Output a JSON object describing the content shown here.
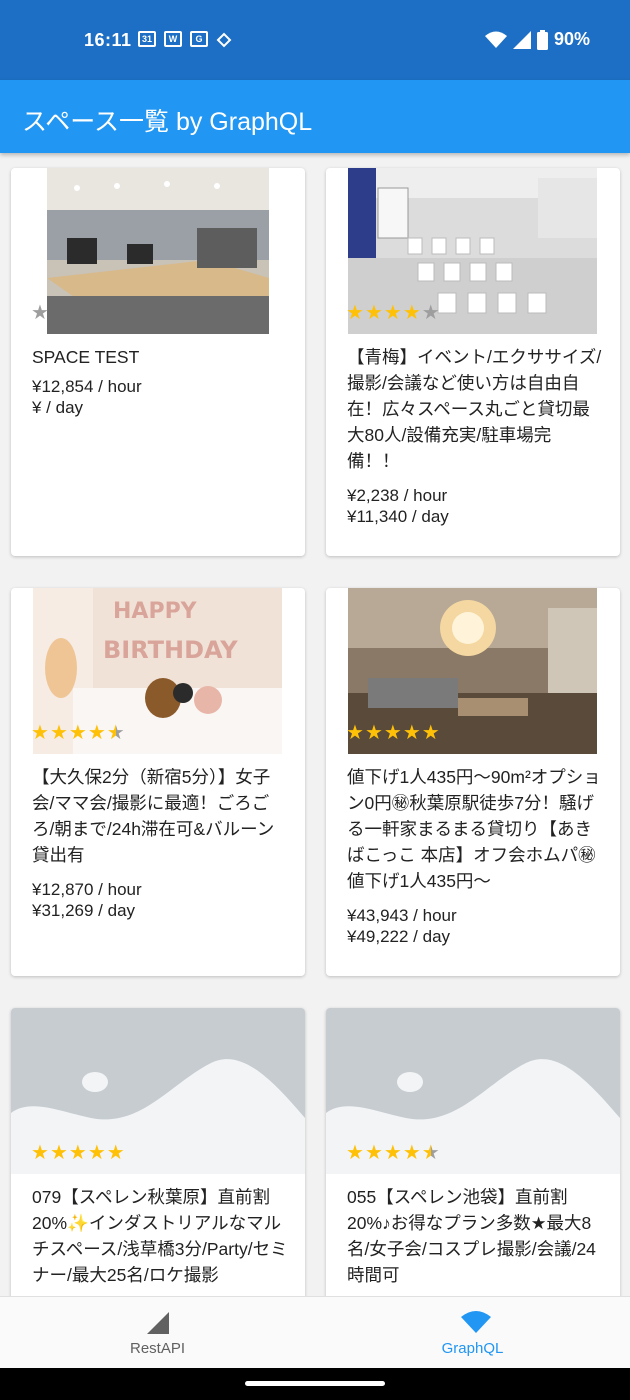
{
  "status_bar": {
    "time": "16:11",
    "battery": "90%"
  },
  "app_bar": {
    "title": "スペース一覧 by GraphQL"
  },
  "spaces": [
    {
      "name": "SPACE TEST",
      "price_hour": "¥12,854 / hour",
      "price_day": "¥ / day",
      "rating": 0,
      "image": "office"
    },
    {
      "name": "【青梅】イベント/エクササイズ/撮影/会議など使い方は自由自在！広々スペース丸ごと貸切最大80人/設備充実/駐車場完備！！",
      "price_hour": "¥2,238 / hour",
      "price_day": "¥11,340 / day",
      "rating": 4,
      "image": "event-hall"
    },
    {
      "name": "【大久保2分（新宿5分）】女子会/ママ会/撮影に最適！ごろごろ/朝まで/24h滞在可&バルーン貸出有",
      "price_hour": "¥12,870 / hour",
      "price_day": "¥31,269 / day",
      "rating": 4.5,
      "image": "birthday-room"
    },
    {
      "name": "値下げ1人435円～90m²オプション0円㊙秋葉原駅徒歩7分！騒げる一軒家まるまる貸切り【あきばこっこ 本店】オフ会ホムパ㊙値下げ1人435円～",
      "price_hour": "¥43,943 / hour",
      "price_day": "¥49,222 / day",
      "rating": 5,
      "image": "lounge"
    },
    {
      "name": "079【スペレン秋葉原】直前割20%✨インダストリアルなマルチスペース/浅草橋3分/Party/セミナー/最大25名/ロケ撮影",
      "price_hour": "",
      "price_day": "",
      "rating": 5,
      "image": "placeholder"
    },
    {
      "name": "055【スペレン池袋】直前割20%♪お得なプラン多数★最大8名/女子会/コスプレ撮影/会議/24時間可",
      "price_hour": "",
      "price_day": "",
      "rating": 4.5,
      "image": "placeholder"
    }
  ],
  "bottom_nav": {
    "items": [
      {
        "label": "RestAPI",
        "icon": "signal-icon",
        "active": false
      },
      {
        "label": "GraphQL",
        "icon": "wifi-icon",
        "active": true
      }
    ]
  },
  "colors": {
    "status_bar": "#1c6fc4",
    "app_bar": "#2196f3",
    "active_nav": "#2196f3",
    "star": "#ffc107"
  }
}
